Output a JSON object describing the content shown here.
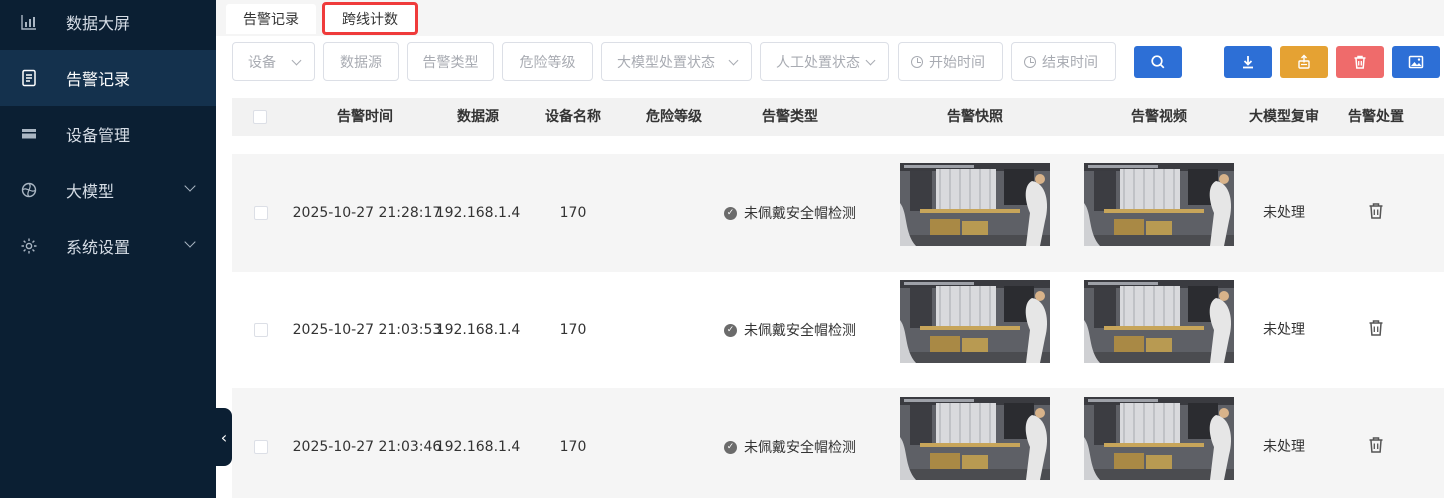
{
  "sidebar": {
    "items": [
      {
        "label": "数据大屏",
        "icon": "bar-chart-icon"
      },
      {
        "label": "告警记录",
        "icon": "document-list-icon"
      },
      {
        "label": "设备管理",
        "icon": "device-stack-icon"
      },
      {
        "label": "大模型",
        "icon": "model-swirl-icon"
      },
      {
        "label": "系统设置",
        "icon": "gear-icon"
      }
    ],
    "active_index": 1,
    "collapse_glyph": "‹"
  },
  "tabs": [
    {
      "label": "告警记录"
    },
    {
      "label": "跨线计数"
    }
  ],
  "filters": {
    "device": "设备",
    "data_source": "数据源",
    "alarm_type": "告警类型",
    "danger_level": "危险等级",
    "llm_status": "大模型处置状态",
    "manual_status": "人工处置状态",
    "start_time": "开始时间",
    "end_time": "结束时间"
  },
  "toolbar": {
    "search_icon": "search-icon",
    "download_icon": "download-icon",
    "export_icon": "export-icon",
    "delete_icon": "trash-icon",
    "image_icon": "image-icon"
  },
  "table": {
    "headers": {
      "time": "告警时间",
      "source": "数据源",
      "device_name": "设备名称",
      "danger": "危险等级",
      "type": "告警类型",
      "snapshot": "告警快照",
      "video": "告警视频",
      "llm_review": "大模型复审",
      "handle": "告警处置"
    },
    "rows": [
      {
        "time": "2025-10-27 21:28:17",
        "source": "192.168.1.4",
        "device_name": "170",
        "danger": "",
        "type": "未佩戴安全帽检测",
        "llm_review": "未处理"
      },
      {
        "time": "2025-10-27 21:03:53",
        "source": "192.168.1.4",
        "device_name": "170",
        "danger": "",
        "type": "未佩戴安全帽检测",
        "llm_review": "未处理"
      },
      {
        "time": "2025-10-27 21:03:46",
        "source": "192.168.1.4",
        "device_name": "170",
        "danger": "",
        "type": "未佩戴安全帽检测",
        "llm_review": "未处理"
      }
    ]
  }
}
